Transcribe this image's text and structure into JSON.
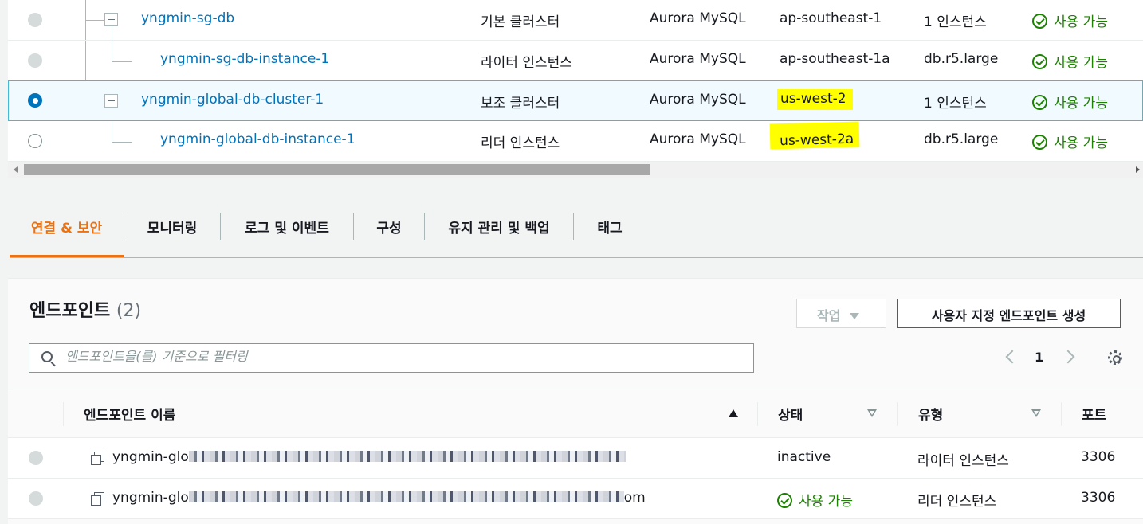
{
  "db_table": {
    "rows": [
      {
        "name": "yngmin-sg-db",
        "role": "기본 클러스터",
        "engine": "Aurora MySQL",
        "region": "ap-southeast-1",
        "size": "1 인스턴스",
        "status": "사용 가능",
        "radio": "disabled"
      },
      {
        "name": "yngmin-sg-db-instance-1",
        "role": "라이터 인스턴스",
        "engine": "Aurora MySQL",
        "region": "ap-southeast-1a",
        "size": "db.r5.large",
        "status": "사용 가능",
        "radio": "disabled"
      },
      {
        "name": "yngmin-global-db-cluster-1",
        "role": "보조 클러스터",
        "engine": "Aurora MySQL",
        "region": "us-west-2",
        "size": "1 인스턴스",
        "status": "사용 가능",
        "radio": "selected",
        "highlight_color": "#ffff00"
      },
      {
        "name": "yngmin-global-db-instance-1",
        "role": "리더 인스턴스",
        "engine": "Aurora MySQL",
        "region": "us-west-2a",
        "size": "db.r5.large",
        "status": "사용 가능",
        "radio": "empty",
        "highlight_color": "#ffff00"
      }
    ]
  },
  "tabs": [
    {
      "label": "연결 & 보안",
      "active": true
    },
    {
      "label": "모니터링"
    },
    {
      "label": "로그 및 이벤트"
    },
    {
      "label": "구성"
    },
    {
      "label": "유지 관리 및 백업"
    },
    {
      "label": "태그"
    }
  ],
  "endpoints": {
    "title": "엔드포인트",
    "count": "(2)",
    "action_button": "작업",
    "create_button": "사용자 지정 엔드포인트 생성",
    "search_placeholder": "엔드포인트을(를) 기준으로 필터링",
    "page": "1",
    "columns": [
      "엔드포인트 이름",
      "상태",
      "유형",
      "포트"
    ],
    "rows": [
      {
        "name_prefix": "yngmin-glo",
        "name_suffix": "",
        "status": "inactive",
        "type": "라이터 인스턴스",
        "port": "3306"
      },
      {
        "name_prefix": "yngmin-glo",
        "name_suffix": "om",
        "status": "사용 가능",
        "type": "리더 인스턴스",
        "port": "3306"
      }
    ]
  },
  "colors": {
    "accent": "#ec7211",
    "link": "#0073bb",
    "success": "#1d8102"
  }
}
